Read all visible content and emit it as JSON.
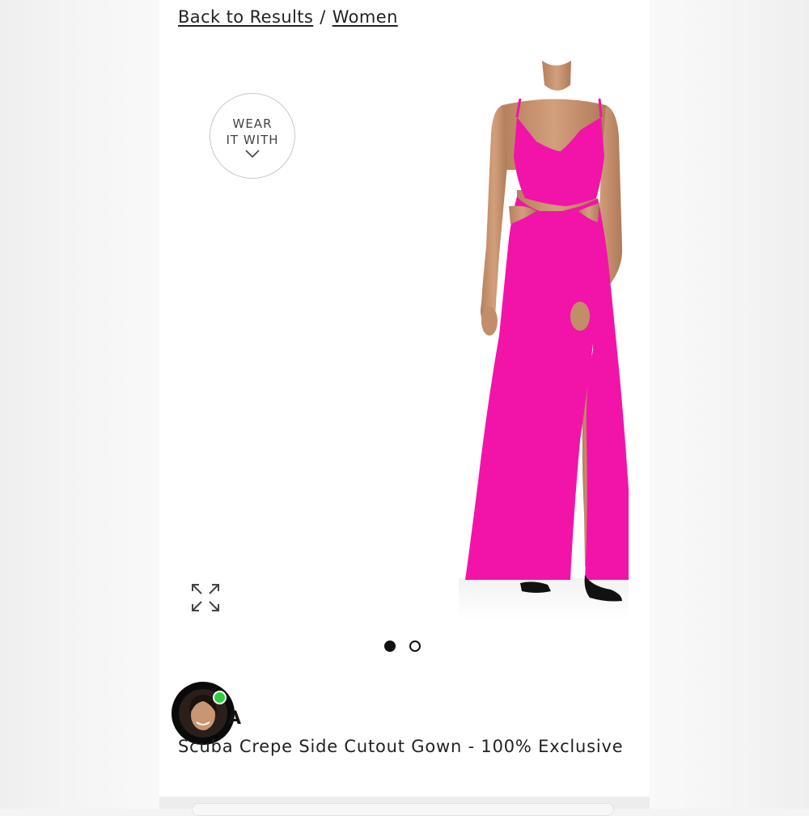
{
  "breadcrumb": {
    "back_label": "Back to Results",
    "separator": "/",
    "category_label": "Women"
  },
  "wear_it_with": {
    "line1": "WEAR",
    "line2": "IT WITH",
    "icon": "chevron-down-icon"
  },
  "gallery": {
    "expand_icon": "expand-arrows-icon",
    "total_images": 2,
    "active_index": 1,
    "dress_color": "#f214a8"
  },
  "seller": {
    "online_color": "#2fd13a",
    "brand_fragment": "A"
  },
  "product": {
    "title": "Scuba Crepe Side Cutout Gown - 100% Exclusive"
  }
}
